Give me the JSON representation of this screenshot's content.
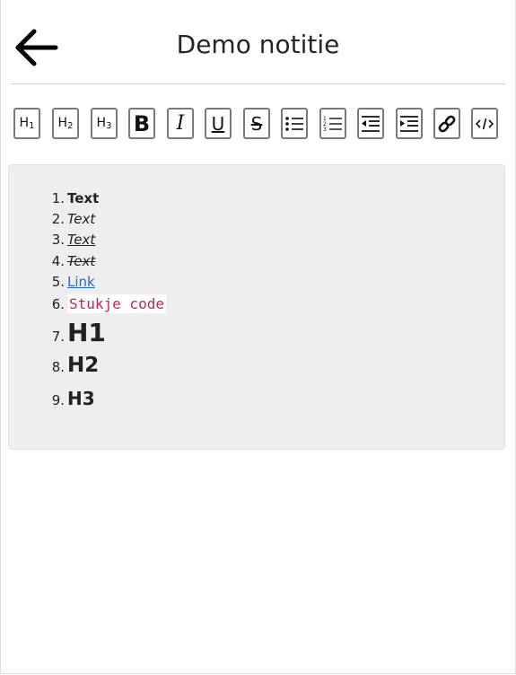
{
  "header": {
    "title": "Demo notitie",
    "back_icon": "arrow-left-icon"
  },
  "toolbar": {
    "buttons": [
      {
        "name": "h1",
        "label": "H",
        "sub": "1",
        "icon": "heading-1-icon"
      },
      {
        "name": "h2",
        "label": "H",
        "sub": "2",
        "icon": "heading-2-icon"
      },
      {
        "name": "h3",
        "label": "H",
        "sub": "3",
        "icon": "heading-3-icon"
      },
      {
        "name": "bold",
        "label": "B",
        "icon": "bold-icon"
      },
      {
        "name": "italic",
        "label": "I",
        "icon": "italic-icon"
      },
      {
        "name": "underline",
        "label": "U",
        "icon": "underline-icon"
      },
      {
        "name": "strikethrough",
        "label": "S",
        "icon": "strikethrough-icon"
      },
      {
        "name": "bullet-list",
        "icon": "bullet-list-icon"
      },
      {
        "name": "numbered-list",
        "icon": "numbered-list-icon"
      },
      {
        "name": "outdent",
        "icon": "outdent-icon"
      },
      {
        "name": "indent",
        "icon": "indent-icon"
      },
      {
        "name": "link",
        "icon": "link-icon"
      },
      {
        "name": "code",
        "icon": "code-icon"
      }
    ]
  },
  "editor": {
    "items": [
      {
        "num": "1.",
        "text": "Text",
        "style": "bold"
      },
      {
        "num": "2.",
        "text": "Text",
        "style": "italic"
      },
      {
        "num": "3.",
        "text": "Text",
        "style": "underline"
      },
      {
        "num": "4.",
        "text": "Text",
        "style": "strike"
      },
      {
        "num": "5.",
        "text": "Link",
        "style": "link"
      },
      {
        "num": "6.",
        "text": "Stukje code",
        "style": "code"
      },
      {
        "num": "7.",
        "text": "H1",
        "style": "h1"
      },
      {
        "num": "8.",
        "text": "H2",
        "style": "h2"
      },
      {
        "num": "9.",
        "text": "H3",
        "style": "h3"
      }
    ]
  },
  "colors": {
    "link": "#1a6ed6",
    "code": "#c7254e",
    "editor_bg": "#eeeeee"
  }
}
